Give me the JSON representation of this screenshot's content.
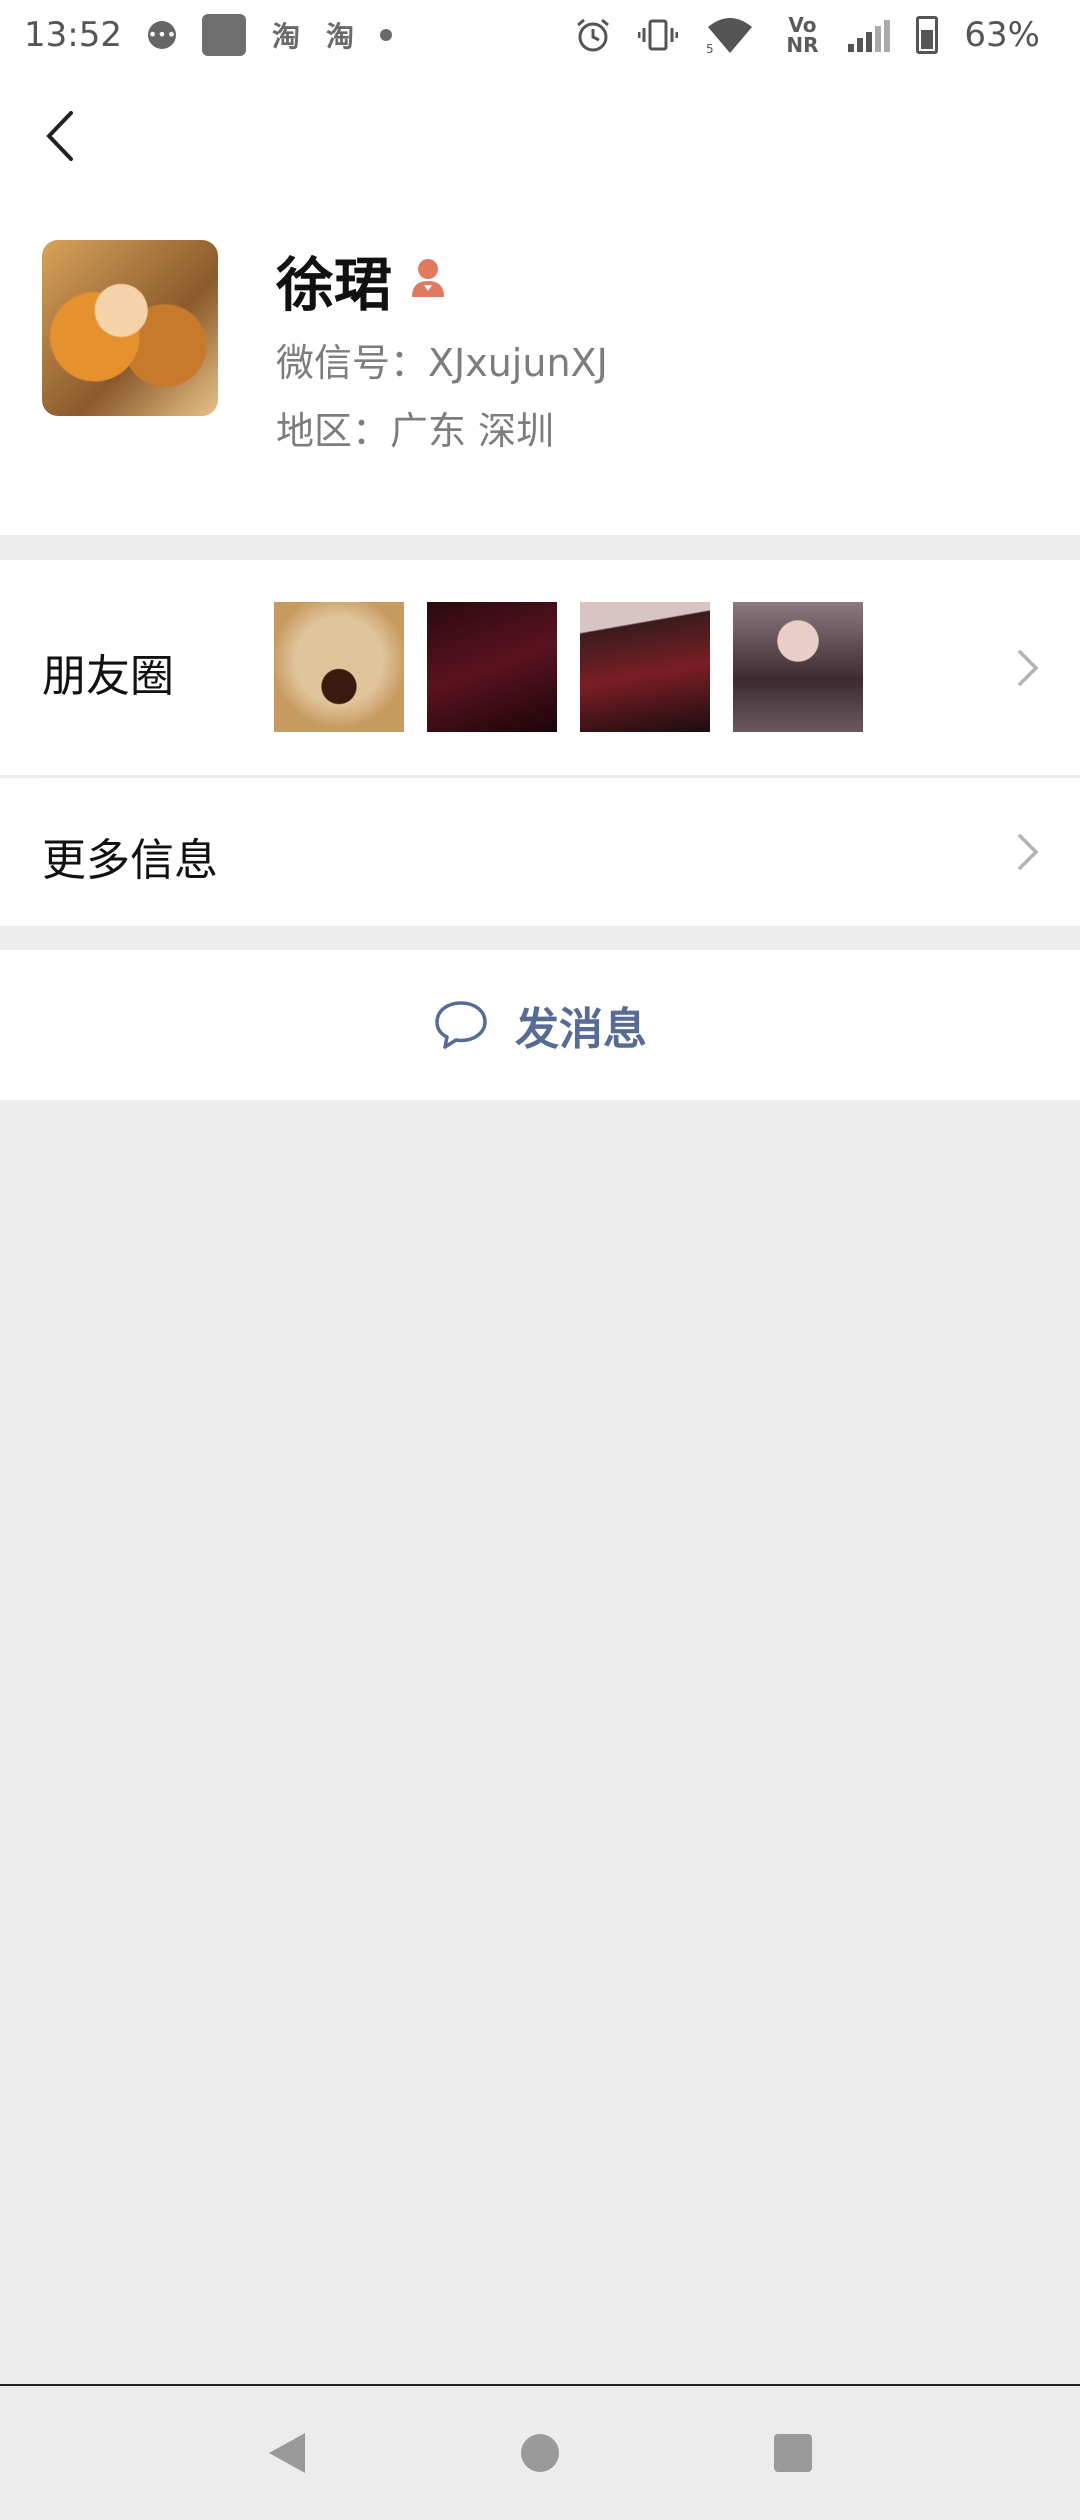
{
  "status_bar": {
    "time": "13:52",
    "battery": "63%",
    "icons": [
      "chat-bubble-icon",
      "app-square-icon",
      "taobao-icon",
      "taobao-icon",
      "dot-icon",
      "alarm-icon",
      "vibrate-icon",
      "wifi-icon",
      "volte-nr-icon",
      "signal-icon",
      "battery-icon"
    ],
    "tao1": "淘",
    "tao2": "淘",
    "volte": "Vo NR"
  },
  "profile": {
    "name": "徐珺",
    "wechat_id": "微信号：XJxujunXJ",
    "region": "地区：广东  深圳",
    "gender_icon": "female-icon"
  },
  "rows": {
    "moments_label": "朋友圈",
    "more_info_label": "更多信息",
    "send_message_label": "发消息"
  },
  "colors": {
    "link_blue": "#576b95",
    "gender_orange": "#e07a5f",
    "background": "#ededed"
  },
  "nav_icons": [
    "back-triangle-icon",
    "home-circle-icon",
    "recents-square-icon"
  ]
}
